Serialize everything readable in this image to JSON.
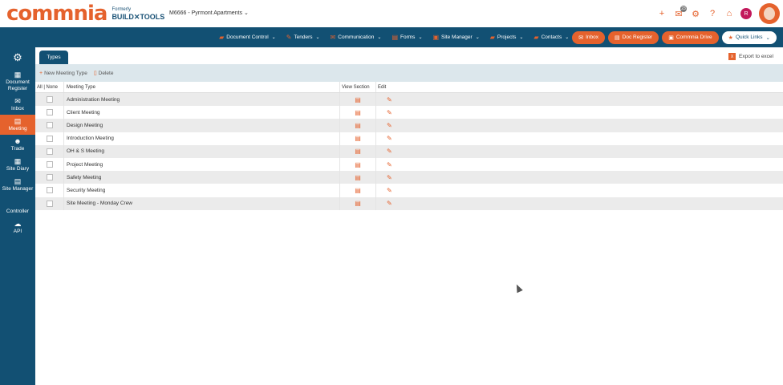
{
  "brand": {
    "logo_text": "commnia",
    "formerly": "Formerly",
    "build_tools": "BUILD✕TOOLS"
  },
  "project": {
    "name": "M6666 - Pyrmont Apartments",
    "chevron": "⌄"
  },
  "top_icons": {
    "add": "+",
    "mail": "✉",
    "mail_badge": "23",
    "gear": "⚙",
    "help": "?",
    "home": "⌂",
    "user_initial": "R"
  },
  "navbar": {
    "items": [
      {
        "label": "Document Control",
        "icon": "▰"
      },
      {
        "label": "Tenders",
        "icon": "✎"
      },
      {
        "label": "Communication",
        "icon": "✉"
      },
      {
        "label": "Forms",
        "icon": "▤"
      },
      {
        "label": "Site Manager",
        "icon": "▣"
      },
      {
        "label": "Projects",
        "icon": "▰"
      },
      {
        "label": "Contacts",
        "icon": "▰"
      }
    ],
    "chevron": "⌄",
    "pills": [
      {
        "label": "Inbox",
        "icon": "✉"
      },
      {
        "label": "Doc Register",
        "icon": "▤"
      },
      {
        "label": "Commnia Drive",
        "icon": "▣"
      }
    ],
    "quick_links": {
      "label": "Quick Links",
      "icon": "★",
      "chevron": "⌄"
    }
  },
  "sidebar": {
    "gear": "⚙",
    "items": [
      {
        "label": "Document Register",
        "icon": "▦",
        "active": false
      },
      {
        "label": "Inbox",
        "icon": "✉",
        "active": false
      },
      {
        "label": "Meeting",
        "icon": "▤",
        "active": true
      },
      {
        "label": "Trade",
        "icon": "☻",
        "active": false
      },
      {
        "label": "Site Diary",
        "icon": "▦",
        "active": false
      },
      {
        "label": "Site Manager",
        "icon": "▤",
        "active": false
      },
      {
        "label": "Controller",
        "icon": "",
        "active": false
      },
      {
        "label": "API",
        "icon": "☁",
        "active": false
      }
    ]
  },
  "tabs": {
    "active": "Types"
  },
  "export": {
    "label": "Export to excel",
    "icon": "X"
  },
  "toolbar": {
    "new_label": "New Meeting Type",
    "new_icon": "+",
    "delete_label": "Delete",
    "delete_icon": "▯"
  },
  "grid": {
    "headers": {
      "select": "All | None",
      "type": "Meeting Type",
      "view": "View Section",
      "edit": "Edit"
    },
    "view_icon": "▤",
    "edit_icon": "✎",
    "rows": [
      "Administration Meeting",
      "Client Meeting",
      "Design Meeting",
      "Introduction Meeting",
      "OH & S Meeting",
      "Project Meeting",
      "Safety Meeting",
      "Security Meeting",
      "Site Meeting - Monday Crew"
    ]
  },
  "colors": {
    "brand_blue": "#125073",
    "accent_orange": "#e5622d",
    "toolbar_bg": "#dce7ec"
  }
}
